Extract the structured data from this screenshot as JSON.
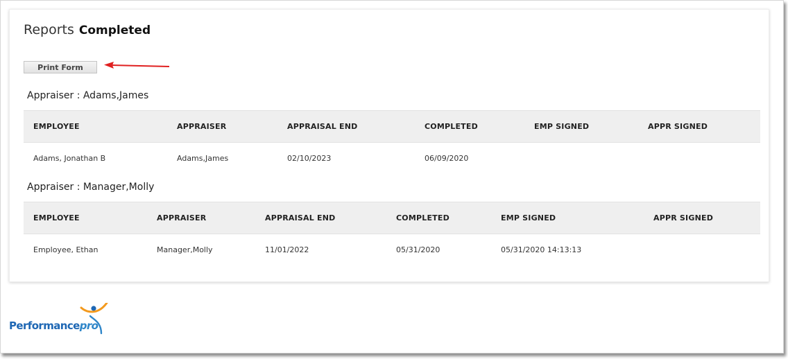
{
  "header": {
    "section": "Reports",
    "subtitle": "Completed"
  },
  "toolbar": {
    "print_label": "Print Form"
  },
  "groups": [
    {
      "heading": "Appraiser : Adams,James",
      "columns": [
        "EMPLOYEE",
        "APPRAISER",
        "APPRAISAL END",
        "COMPLETED",
        "EMP SIGNED",
        "APPR SIGNED"
      ],
      "rows": [
        {
          "employee": "Adams, Jonathan B",
          "appraiser": "Adams,James",
          "appraisal_end": "02/10/2023",
          "completed": "06/09/2020",
          "emp_signed": "",
          "appr_signed": ""
        }
      ]
    },
    {
      "heading": "Appraiser : Manager,Molly",
      "columns": [
        "EMPLOYEE",
        "APPRAISER",
        "APPRAISAL END",
        "COMPLETED",
        "EMP SIGNED",
        "APPR SIGNED"
      ],
      "rows": [
        {
          "employee": "Employee, Ethan",
          "appraiser": "Manager,Molly",
          "appraisal_end": "11/01/2022",
          "completed": "05/31/2020",
          "emp_signed": "05/31/2020 14:13:13",
          "appr_signed": ""
        }
      ]
    }
  ],
  "logo": {
    "part1": "Performance",
    "part2": "pro"
  },
  "colors": {
    "arrow": "#e02020",
    "logo_blue": "#1e67b4",
    "logo_orange": "#f39a1e",
    "header_bg": "#efefef"
  }
}
